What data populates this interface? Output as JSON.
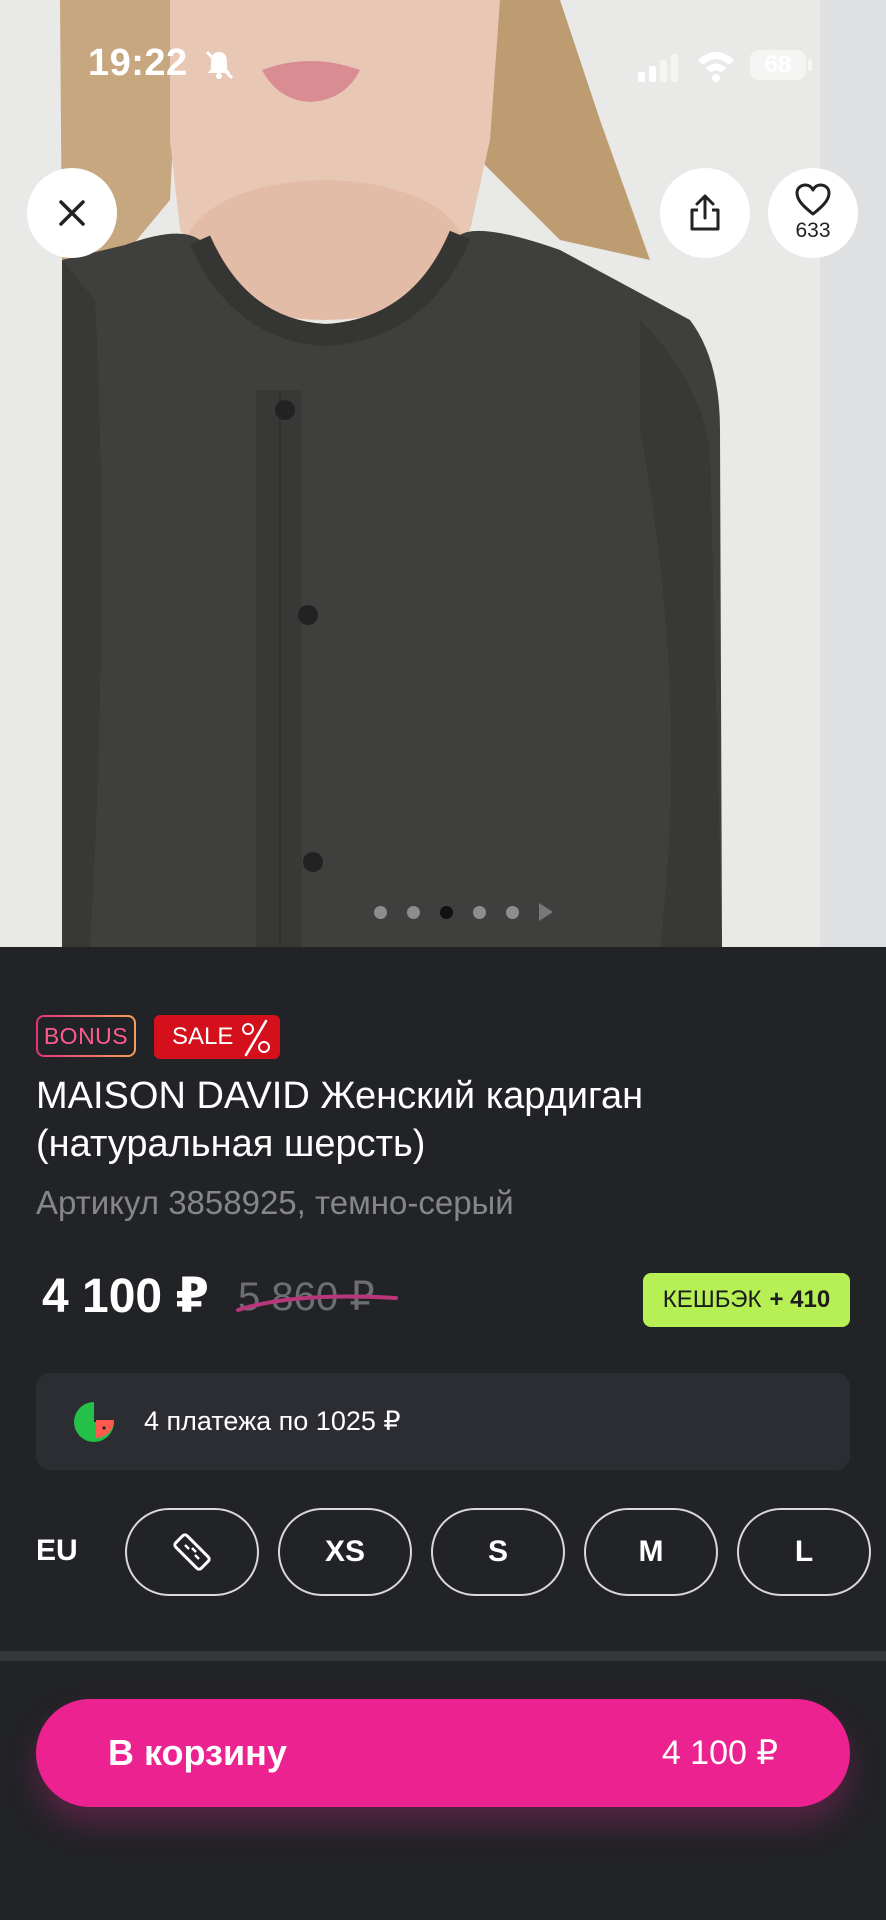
{
  "status_bar": {
    "time": "19:22",
    "battery": "68"
  },
  "hero": {
    "favorites_count": "633",
    "slides_total": 5,
    "active_slide": 3
  },
  "badges": {
    "bonus": "BONUS",
    "sale": "SALE"
  },
  "product": {
    "title": "MAISON DAVID Женский кардиган (натуральная шерсть)",
    "article": "Артикул 3858925, темно-серый",
    "price": "4 100 ₽",
    "old_price": "5 860 ₽",
    "cashback_label": "КЕШБЭК",
    "cashback_value": "+ 410"
  },
  "installment": {
    "text": "4 платежа по 1025 ₽"
  },
  "sizes": {
    "system": "EU",
    "options": [
      "XS",
      "S",
      "M",
      "L"
    ]
  },
  "cart": {
    "label": "В корзину",
    "price": "4 100 ₽"
  },
  "colors": {
    "accent": "#ec2290",
    "cashback": "#b7f055",
    "sale": "#d4101c",
    "background": "#222327"
  }
}
